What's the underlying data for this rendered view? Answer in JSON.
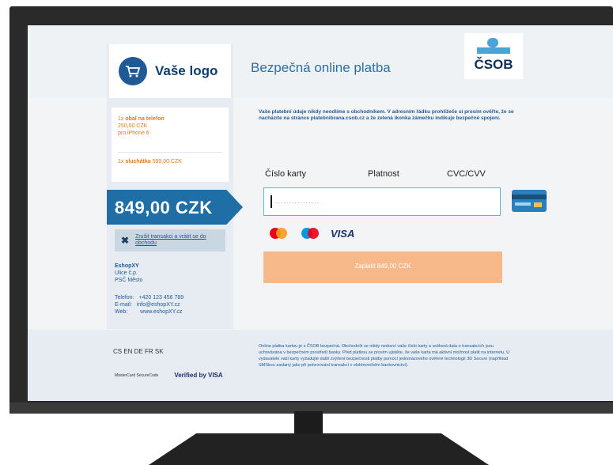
{
  "header": {
    "logo_label": "Vaše logo",
    "title": "Bezpečná online platba",
    "bank_name": "ČSOB"
  },
  "cart": {
    "items": [
      {
        "qty": "1x",
        "name": "obal na telefon",
        "price": "250,00 CZK",
        "detail": "pro iPhone 6"
      },
      {
        "qty": "1x",
        "name": "sluchátka",
        "price": "599,00 CZK"
      }
    ]
  },
  "total": {
    "amount": "849,00 CZK"
  },
  "cancel": {
    "label": "Zrušit transakci a vrátit se do obchodu"
  },
  "shop": {
    "name": "EshopXY",
    "street": "Ulice č.p.",
    "city": "PSČ Město",
    "phone_label": "Telefon:",
    "phone": "+420 123 456 789",
    "email_label": "E-mail:",
    "email": "info@eshopXY.cz",
    "web_label": "Web:",
    "web": "www.eshopXY.cz"
  },
  "notice": "Vaše platební údaje nikdy neodlíme s obchodníkem. V adresním řádku prohlížeče si prosím ověřte, že se nacházíte na stránce platebnibrana.csob.cz a že zelená ikonka zámečku indikuje bezpečné spojení.",
  "form": {
    "card_number_label": "Číslo karty",
    "expiry_label": "Platnost",
    "cvc_label": "CVC/CVV",
    "card_placeholder": "................",
    "brands": [
      "mastercard-icon",
      "maestro-icon",
      "VISA"
    ],
    "pay_label": "Zaplatit 849,00 CZK"
  },
  "footer": {
    "languages": "CS  EN  DE  FR  SK",
    "text": "Online platba kartou je s ČSOB bezpečná. Obchodník se nikdy nedozví vaše číslo karty a veškerá data o transakcích jsou uchovávána v bezpečném prostředí banky. Před platbou se prosím ujistěte, že vaše karta má aktivní možnost platit na internetu. U vydavatele vaší karty vyžadujte další zvýšení bezpečnosti platby pomocí jednorázového ověření technologií 3D Secure (například SMSkou zaslaný jako při potvrzování transakcí v elektronickém bankovnictví).",
    "mc_label": "MasterCard SecureCode",
    "visa_label": "Verified by VISA"
  },
  "colors": {
    "primary": "#1f6fa6",
    "accent": "#f7b98a",
    "link": "#1f5a96",
    "input_border": "#59b7d4"
  }
}
